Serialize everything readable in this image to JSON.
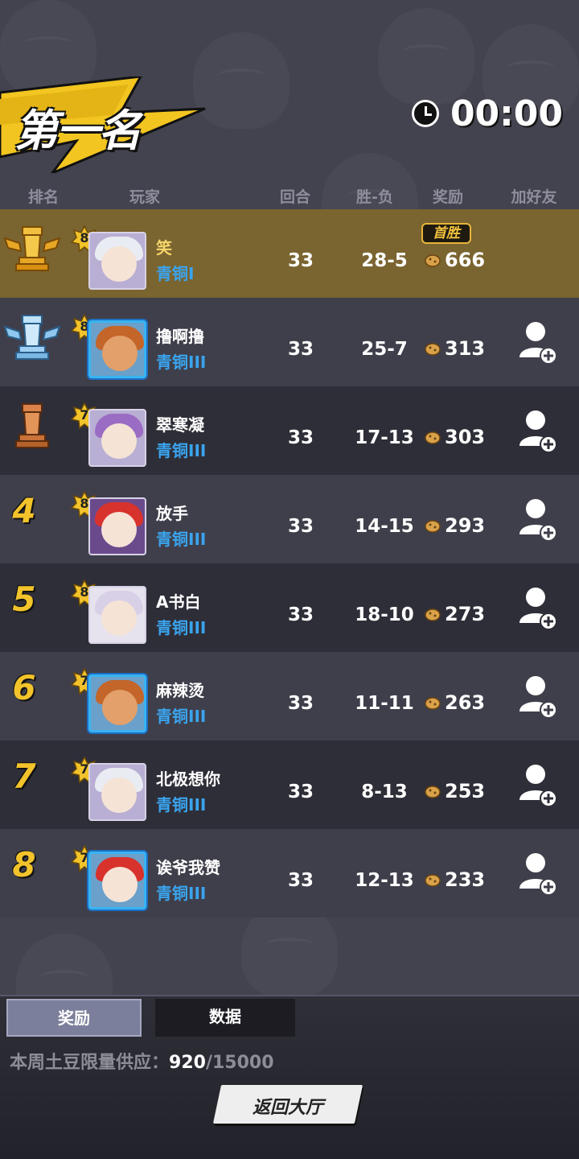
{
  "header": {
    "title": "第一名",
    "timer": "00:00"
  },
  "columns": {
    "rank": "排名",
    "player": "玩家",
    "rounds": "回合",
    "record": "胜-负",
    "reward": "奖励",
    "add_friend": "加好友"
  },
  "first_win_label": "首胜",
  "rows": [
    {
      "rank": "1",
      "level": "8",
      "name": "笑",
      "tier": "青铜I",
      "rounds": "33",
      "record": "28-5",
      "reward": "666",
      "avatar": "white-hair-girl",
      "frame": "plain"
    },
    {
      "rank": "2",
      "level": "8",
      "name": "撸啊撸",
      "tier": "青铜III",
      "rounds": "33",
      "record": "25-7",
      "reward": "313",
      "avatar": "lion-warrior",
      "frame": "blue"
    },
    {
      "rank": "3",
      "level": "7",
      "name": "翠寒凝",
      "tier": "青铜III",
      "rounds": "33",
      "record": "17-13",
      "reward": "303",
      "avatar": "purple-hair-girl",
      "frame": "plain"
    },
    {
      "rank": "4",
      "level": "8",
      "name": "放手",
      "tier": "青铜III",
      "rounds": "33",
      "record": "14-15",
      "reward": "293",
      "avatar": "red-hair-warrior",
      "frame": "plain"
    },
    {
      "rank": "5",
      "level": "8",
      "name": "A书白",
      "tier": "青铜III",
      "rounds": "33",
      "record": "18-10",
      "reward": "273",
      "avatar": "silver-hair-elf",
      "frame": "plain"
    },
    {
      "rank": "6",
      "level": "7",
      "name": "麻辣烫",
      "tier": "青铜III",
      "rounds": "33",
      "record": "11-11",
      "reward": "263",
      "avatar": "lion-warrior",
      "frame": "blue"
    },
    {
      "rank": "7",
      "level": "7",
      "name": "北极想你",
      "tier": "青铜III",
      "rounds": "33",
      "record": "8-13",
      "reward": "253",
      "avatar": "white-hair-girl",
      "frame": "plain"
    },
    {
      "rank": "8",
      "level": "7",
      "name": "诶爷我赞",
      "tier": "青铜III",
      "rounds": "33",
      "record": "12-13",
      "reward": "233",
      "avatar": "red-hair-boy",
      "frame": "blue"
    }
  ],
  "tabs": {
    "reward": "奖励",
    "data": "数据"
  },
  "supply": {
    "label": "本周土豆限量供应：",
    "current": "920",
    "total": "/15000"
  },
  "back_button": "返回大厅",
  "colors": {
    "background": "#43434f",
    "first_row": "#7a6430",
    "gold": "#f2c32b",
    "tier_blue": "#3aa4ee"
  }
}
